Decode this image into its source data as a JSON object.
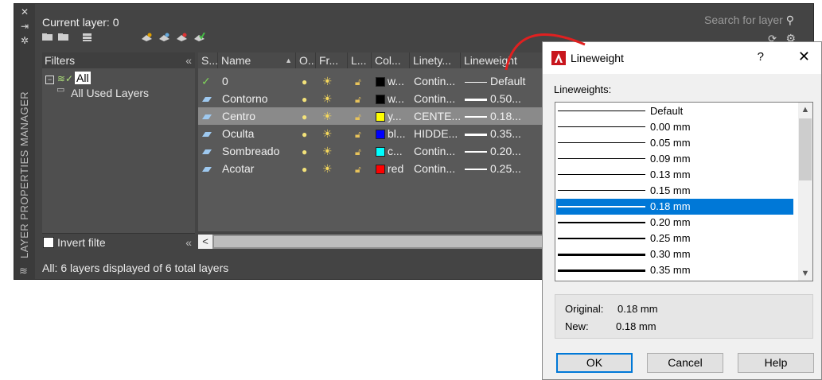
{
  "palette": {
    "side_title": "LAYER PROPERTIES MANAGER",
    "current_layer": "Current layer: 0",
    "search_placeholder": "Search for layer",
    "filters": {
      "header": "Filters",
      "tree_all": "All",
      "tree_used": "All Used Layers",
      "invert_label": "Invert filte"
    },
    "columns": [
      "S...",
      "Name",
      "O...",
      "Fr...",
      "L...",
      "Col...",
      "Linety...",
      "Lineweight"
    ],
    "rows": [
      {
        "name": "0",
        "color_name": "w...",
        "color": "#000000",
        "linetype": "Contin...",
        "lineweight": "Default",
        "current": true
      },
      {
        "name": "Contorno",
        "color_name": "w...",
        "color": "#000000",
        "linetype": "Contin...",
        "lineweight": "0.50...",
        "current": false
      },
      {
        "name": "Centro",
        "color_name": "y...",
        "color": "#ffff00",
        "linetype": "CENTE...",
        "lineweight": "0.18...",
        "current": false
      },
      {
        "name": "Oculta",
        "color_name": "bl...",
        "color": "#0000ff",
        "linetype": "HIDDE...",
        "lineweight": "0.35...",
        "current": false
      },
      {
        "name": "Sombreado",
        "color_name": "c...",
        "color": "#00ffff",
        "linetype": "Contin...",
        "lineweight": "0.20...",
        "current": false
      },
      {
        "name": "Acotar",
        "color_name": "red",
        "color": "#ff0000",
        "linetype": "Contin...",
        "lineweight": "0.25...",
        "current": false
      }
    ],
    "status": "All: 6 layers displayed of 6 total layers"
  },
  "dialog": {
    "title": "Lineweight",
    "help_glyph": "?",
    "close_glyph": "✕",
    "list_label": "Lineweights:",
    "items": [
      "Default",
      "0.00 mm",
      "0.05 mm",
      "0.09 mm",
      "0.13 mm",
      "0.15 mm",
      "0.18 mm",
      "0.20 mm",
      "0.25 mm",
      "0.30 mm",
      "0.35 mm"
    ],
    "selected_item": "0.18 mm",
    "original_label": "Original:",
    "original_value": "0.18 mm",
    "new_label": "New:",
    "new_value": "0.18 mm",
    "ok_label": "OK",
    "cancel_label": "Cancel",
    "help_label": "Help"
  },
  "colors": {
    "selection_blue": "#0078d7",
    "annotation_red": "#e02020"
  }
}
